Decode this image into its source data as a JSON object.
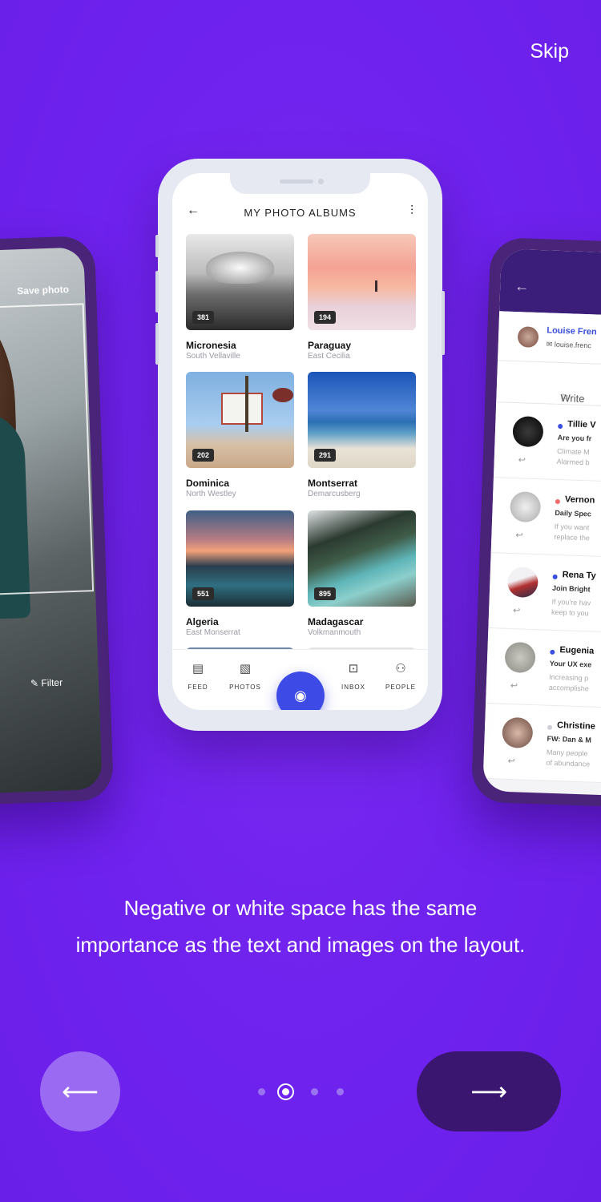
{
  "skip_label": "Skip",
  "caption": {
    "line1": "Negative or white space has the same",
    "line2": "importance as the text and images on the layout."
  },
  "left_phone": {
    "save_label": "Save photo",
    "filter_label": "Filter"
  },
  "right_phone": {
    "sender_name": "Louise Fren",
    "sender_mail": "louise.frenc",
    "compose_placeholder": "Write a new",
    "messages": [
      {
        "name": "Tillie V",
        "subject": "Are you fr",
        "preview": "Climate M\nAlarmed b",
        "dot": "#3a4ee0"
      },
      {
        "name": "Vernon",
        "subject": "Daily Spec",
        "preview": "If you want\nreplace the",
        "dot": "#f06a6a"
      },
      {
        "name": "Rena Ty",
        "subject": "Join Bright",
        "preview": "If you're hav\nkeep to you",
        "dot": "#3a4ee0"
      },
      {
        "name": "Eugenia",
        "subject": "Your UX exe",
        "preview": "Increasing p\naccomplishe",
        "dot": "#3a4ee0"
      },
      {
        "name": "Christine",
        "subject": "FW: Dan & M",
        "preview": "Many people\nof abundance",
        "dot": "#cfcfd8"
      }
    ]
  },
  "main_phone": {
    "title": "MY PHOTO ALBUMS",
    "back_icon": "arrow-left-icon",
    "settings_icon": "sliders-icon",
    "albums": [
      {
        "name": "Micronesia",
        "location": "South Vellaville",
        "count": "381"
      },
      {
        "name": "Paraguay",
        "location": "East Cecilia",
        "count": "194"
      },
      {
        "name": "Dominica",
        "location": "North Westley",
        "count": "202"
      },
      {
        "name": "Montserrat",
        "location": "Demarcusberg",
        "count": "291"
      },
      {
        "name": "Algeria",
        "location": "East Monserrat",
        "count": "551"
      },
      {
        "name": "Madagascar",
        "location": "Volkmanmouth",
        "count": "895"
      }
    ],
    "tabs": [
      {
        "label": "FEED",
        "icon": "feed-icon"
      },
      {
        "label": "PHOTOS",
        "icon": "photos-icon"
      },
      {
        "label": "INBOX",
        "icon": "inbox-icon"
      },
      {
        "label": "PEOPLE",
        "icon": "people-icon"
      }
    ],
    "camera_icon": "camera-icon"
  },
  "pagination": {
    "total": 4,
    "active": 2
  },
  "colors": {
    "background": "#6f22ee",
    "prev_button": "#9b6af2",
    "next_button": "#3a1670",
    "accent": "#3e4ae6"
  }
}
